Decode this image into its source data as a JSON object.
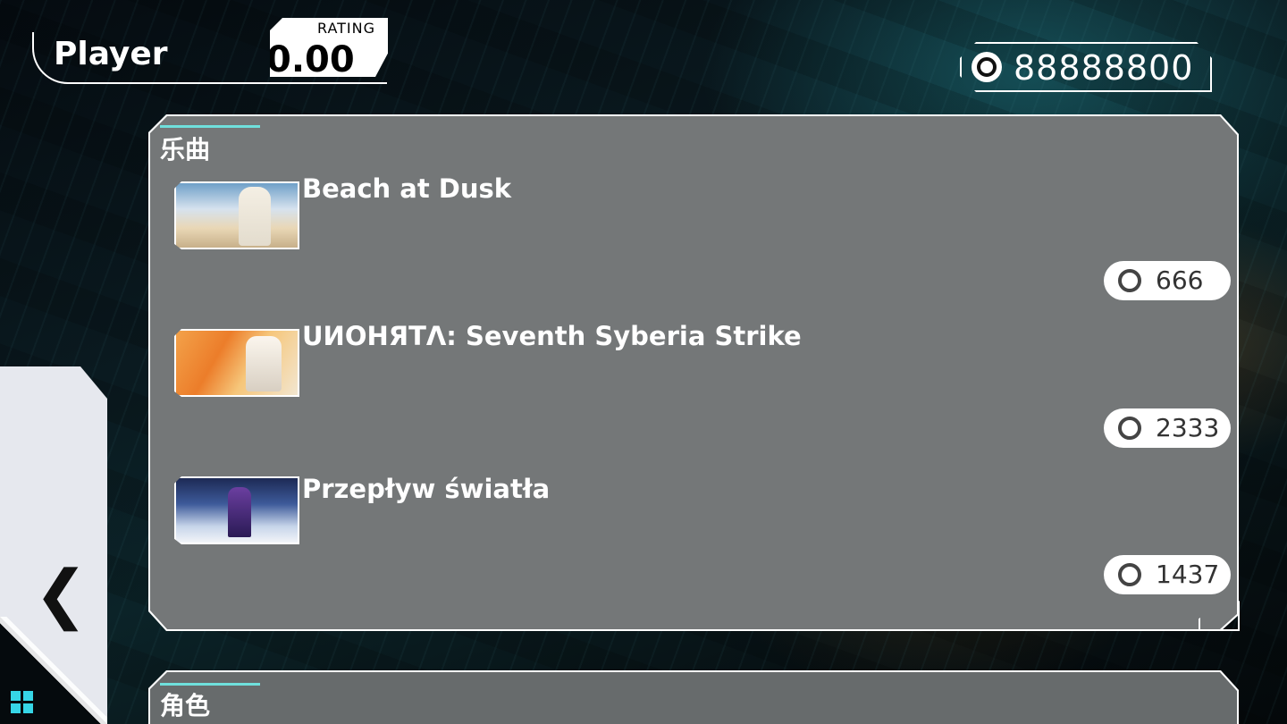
{
  "header": {
    "player_name": "Player",
    "rating_label": "RATING",
    "rating_value": "0.00",
    "currency_value": "88888800",
    "currency_icon": "coin-icon"
  },
  "songs_section": {
    "title": "乐曲",
    "items": [
      {
        "title": "Beach at Dusk",
        "price": "666",
        "thumb_icon": "cover-art"
      },
      {
        "title": "UИOHЯTΛ: Seventh Syberia Strike",
        "price": "2333",
        "thumb_icon": "cover-art"
      },
      {
        "title": "Przepływ światła",
        "price": "1437",
        "thumb_icon": "cover-art"
      }
    ]
  },
  "characters_section": {
    "title": "角色"
  },
  "nav": {
    "back_icon": "chevron-left-icon",
    "menu_icon": "grid-menu-icon"
  },
  "colors": {
    "accent": "#6fe0dc",
    "menu_icon": "#36d6e6",
    "back_tab": "#e6e8ee"
  }
}
